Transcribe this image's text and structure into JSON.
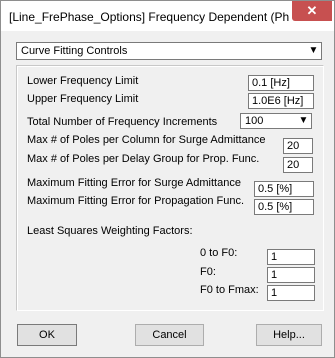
{
  "window": {
    "title": "[Line_FrePhase_Options] Frequency Dependent (Phase) ...",
    "close_glyph": "✕"
  },
  "category": {
    "selected": "Curve Fitting Controls"
  },
  "fields": [
    {
      "label": "Lower Frequency Limit",
      "value": "0.1 [Hz]"
    },
    {
      "label": "Upper Frequency Limit",
      "value": "1.0E6 [Hz]"
    },
    {
      "label": "Total Number of Frequency Increments",
      "value": "100"
    },
    {
      "label": "Max # of Poles per Column for Surge Admittance",
      "value": "20"
    },
    {
      "label": "Max # of Poles per Delay Group for Prop. Func.",
      "value": "20"
    },
    {
      "label": "Maximum Fitting Error for Surge Admittance",
      "value": "0.5 [%]"
    },
    {
      "label": "Maximum Fitting Error for Propagation Func.",
      "value": "0.5 [%]"
    }
  ],
  "weighting": {
    "heading": "Least Squares Weighting Factors:",
    "items": [
      {
        "label": "0 to F0:",
        "value": "1"
      },
      {
        "label": "F0:",
        "value": "1"
      },
      {
        "label": "F0 to Fmax:",
        "value": "1"
      }
    ]
  },
  "buttons": {
    "ok": "OK",
    "cancel": "Cancel",
    "help": "Help..."
  }
}
